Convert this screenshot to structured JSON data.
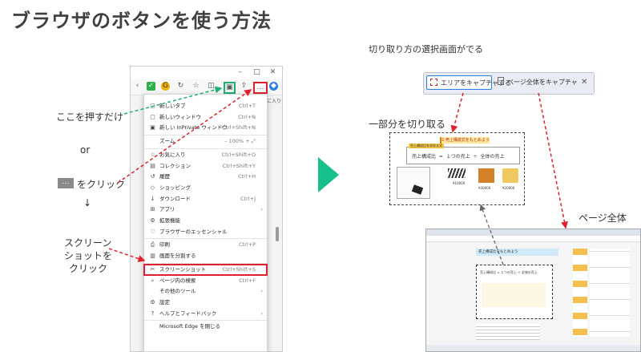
{
  "title": "ブラウザのボタンを使う方法",
  "labels": {
    "press_here": "ここを押すだけ",
    "or": "or",
    "click_dots": "をクリック",
    "dots": "…",
    "down_arrow": "↓",
    "screenshot_click_l1": "スクリーン",
    "screenshot_click_l2": "ショットを",
    "screenshot_click_l3": "クリック",
    "select_screen": "切り取り方の選択画面がでる",
    "cut_part": "一部分を切り取る",
    "whole_page": "ページ全体"
  },
  "browser": {
    "tab_partial": "に入り",
    "more_label": "…",
    "win_controls": [
      "–",
      "□",
      "✕"
    ]
  },
  "menu_items": [
    {
      "icon": "▢",
      "label": "新しいタブ",
      "shortcut": "Ctrl+T",
      "arrow": ""
    },
    {
      "icon": "▢",
      "label": "新しいウィンドウ",
      "shortcut": "Ctrl+N",
      "arrow": ""
    },
    {
      "icon": "▣",
      "label": "新しい InPrivate ウィンドウ",
      "shortcut": "Ctrl+Shift+N",
      "arrow": ""
    },
    {
      "icon": "",
      "label": "ズーム",
      "shortcut": "–   100%   +   ⤢",
      "arrow": ""
    },
    {
      "icon": "☆",
      "label": "お気に入り",
      "shortcut": "Ctrl+Shift+O",
      "arrow": ""
    },
    {
      "icon": "▤",
      "label": "コレクション",
      "shortcut": "Ctrl+Shift+Y",
      "arrow": ""
    },
    {
      "icon": "↺",
      "label": "履歴",
      "shortcut": "Ctrl+H",
      "arrow": ""
    },
    {
      "icon": "◇",
      "label": "ショッピング",
      "shortcut": "",
      "arrow": ""
    },
    {
      "icon": "↓",
      "label": "ダウンロード",
      "shortcut": "Ctrl+J",
      "arrow": ""
    },
    {
      "icon": "⊞",
      "label": "アプリ",
      "shortcut": "",
      "arrow": "›"
    },
    {
      "icon": "⚙",
      "label": "拡張機能",
      "shortcut": "",
      "arrow": ""
    },
    {
      "icon": "♡",
      "label": "ブラウザーのエッセンシャル",
      "shortcut": "",
      "arrow": ""
    },
    {
      "icon": "⎙",
      "label": "印刷",
      "shortcut": "Ctrl+P",
      "arrow": ""
    },
    {
      "icon": "▥",
      "label": "画面を分割する",
      "shortcut": "",
      "arrow": ""
    },
    {
      "icon": "✂",
      "label": "スクリーンショット",
      "shortcut": "Ctrl+Shift+S",
      "arrow": ""
    },
    {
      "icon": "⌕",
      "label": "ページ内の検索",
      "shortcut": "Ctrl+F",
      "arrow": ""
    },
    {
      "icon": "",
      "label": "その他のツール",
      "shortcut": "",
      "arrow": "›"
    },
    {
      "icon": "⚙",
      "label": "設定",
      "shortcut": "",
      "arrow": ""
    },
    {
      "icon": "?",
      "label": "ヘルプとフィードバック",
      "shortcut": "",
      "arrow": "›"
    },
    {
      "icon": "",
      "label": "Microsoft Edge を閉じる",
      "shortcut": "",
      "arrow": ""
    }
  ],
  "capture": {
    "area": "エリアをキャプチャする",
    "full": "ページ全体をキャプチャ",
    "close": "✕"
  },
  "partial_shot": {
    "heading": "2 売上構成式をもとめよう",
    "caption": "売上構成比を求める式",
    "formula": [
      "売上構成比",
      "=",
      "１つの売上",
      "÷",
      "全体の売上"
    ],
    "values": [
      "¥10000",
      "¥30000",
      "¥20000"
    ]
  },
  "full_shot": {
    "heading": "売上構成比をもとめよう",
    "formula": [
      "売上構成比",
      "=",
      "１つの売上",
      "÷",
      "全体の売上"
    ]
  },
  "colors": {
    "accent": "#17c08a",
    "red": "#e02030",
    "green_dash": "#1fb070"
  }
}
